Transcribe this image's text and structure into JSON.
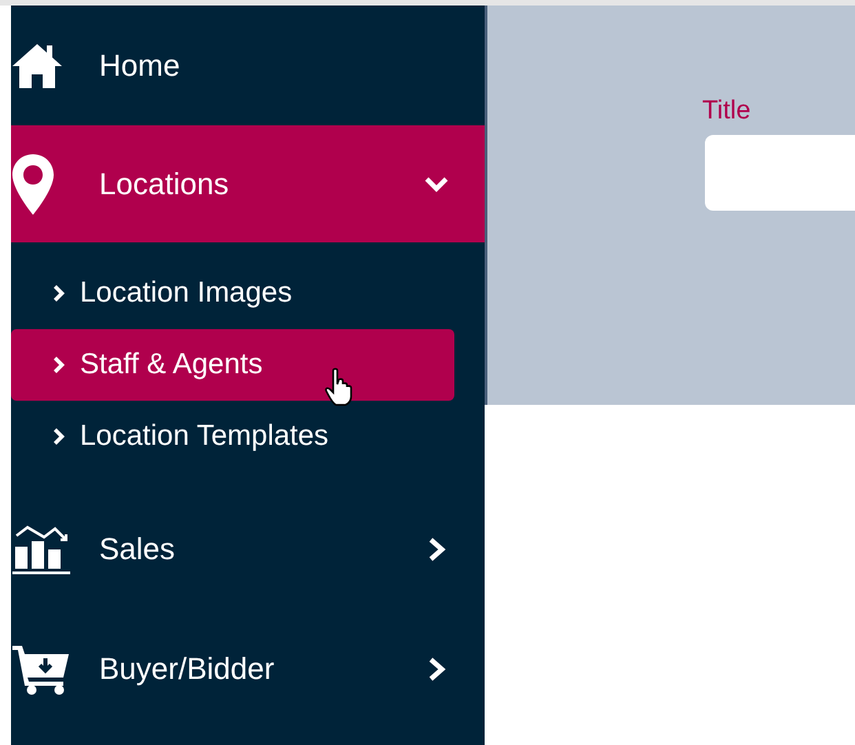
{
  "sidebar": {
    "items": [
      {
        "kind": "link",
        "label": "Home",
        "selected": false
      },
      {
        "kind": "group",
        "label": "Locations",
        "selected": true,
        "expanded": true,
        "children": [
          {
            "label": "Location Images",
            "selected": false
          },
          {
            "label": "Staff & Agents",
            "selected": true
          },
          {
            "label": "Location Templates",
            "selected": false
          }
        ]
      },
      {
        "kind": "group",
        "label": "Sales",
        "selected": false,
        "expanded": false
      },
      {
        "kind": "group",
        "label": "Buyer/Bidder",
        "selected": false,
        "expanded": false
      }
    ]
  },
  "form": {
    "fields": [
      {
        "label": "Title"
      }
    ]
  }
}
